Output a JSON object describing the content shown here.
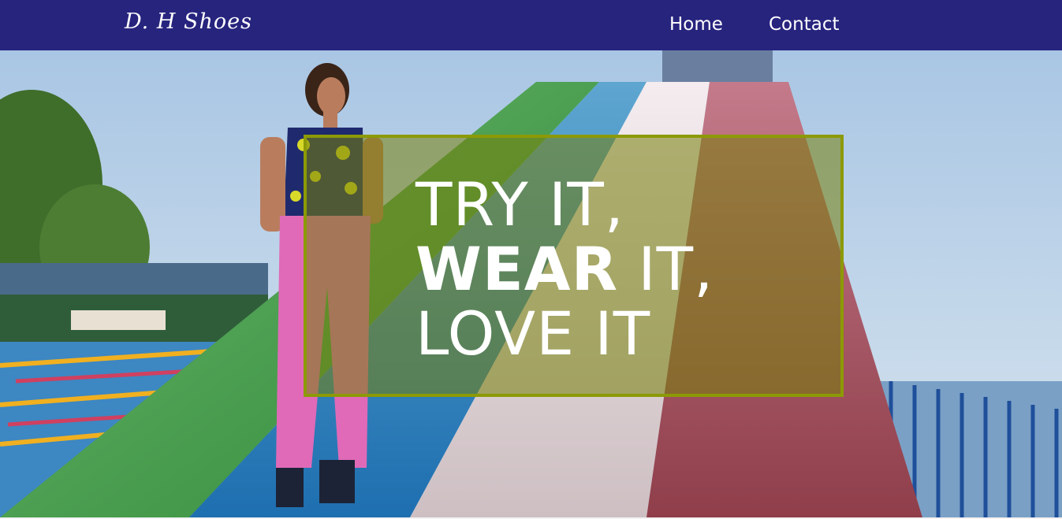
{
  "header": {
    "logo": "D. H Shoes",
    "nav": [
      {
        "label": "Home"
      },
      {
        "label": "Contact"
      }
    ]
  },
  "hero": {
    "line1": "TRY IT,",
    "line2_bold": "WEAR",
    "line2_rest": " IT,",
    "line3": "LOVE IT"
  },
  "colors": {
    "navbar": "#27247e",
    "box_border": "#8c9a06",
    "box_fill": "#76800a"
  }
}
